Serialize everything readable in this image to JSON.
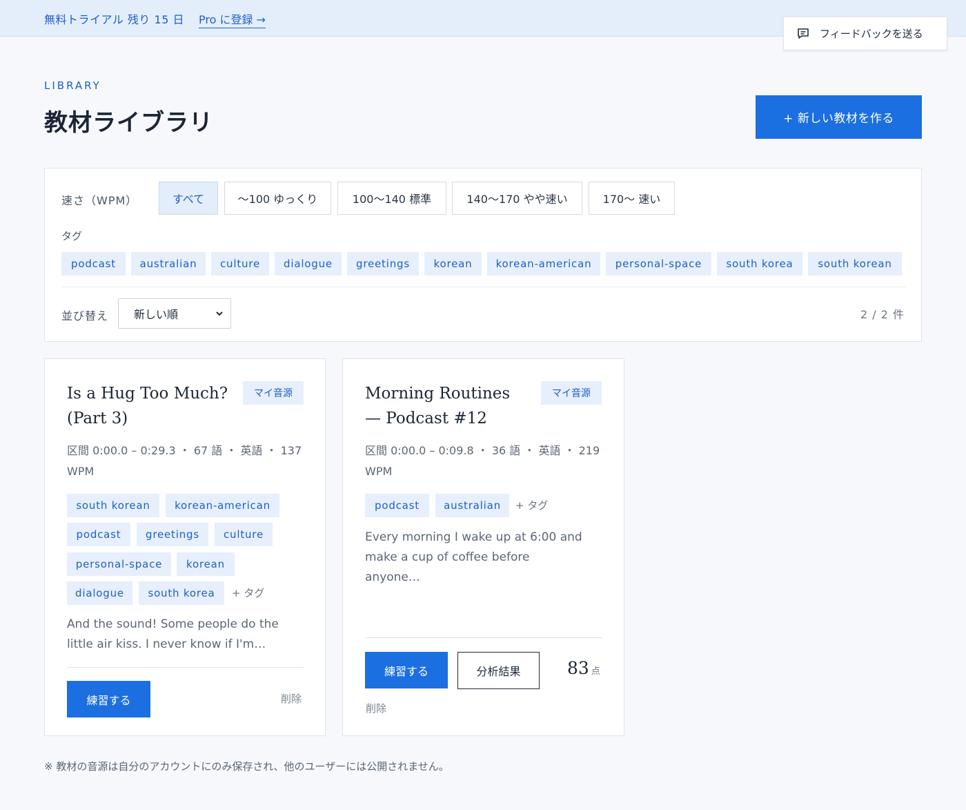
{
  "trial": {
    "text": "無料トライアル 残り 15 日",
    "link": "Pro に登録 →"
  },
  "feedback": {
    "label": "フィードバックを送る",
    "icon": "chat-icon"
  },
  "header": {
    "eyebrow": "LIBRARY",
    "title": "教材ライブラリ",
    "new_button": "+ 新しい教材を作る"
  },
  "filters": {
    "speed_label": "速さ（WPM）",
    "speed_options": [
      "すべて",
      "〜100 ゆっくり",
      "100〜140 標準",
      "140〜170 やや速い",
      "170〜 速い"
    ],
    "speed_selected": "すべて",
    "tag_label": "タグ",
    "tags": [
      "podcast",
      "australian",
      "culture",
      "dialogue",
      "greetings",
      "korean",
      "korean-american",
      "personal-space",
      "south korea",
      "south korean"
    ],
    "sort_label": "並び替え",
    "sort_value": "新しい順",
    "count": "2 / 2 件"
  },
  "cards": [
    {
      "title": "Is a Hug Too Much? (Part 3)",
      "badge": "マイ音源",
      "meta": "区間 0:00.0 – 0:29.3 ・ 67 語 ・ 英語 ・ 137 WPM",
      "tags": [
        "south korean",
        "korean-american",
        "podcast",
        "greetings",
        "culture",
        "personal-space",
        "korean",
        "dialogue",
        "south korea"
      ],
      "add_tag": "+ タグ",
      "excerpt": "And the sound! Some people do the little air kiss. I never know if I'm…",
      "practice": "練習する",
      "delete": "削除"
    },
    {
      "title": "Morning Routines — Podcast #12",
      "badge": "マイ音源",
      "meta": "区間 0:00.0 – 0:09.8 ・ 36 語 ・ 英語 ・ 219 WPM",
      "tags": [
        "podcast",
        "australian"
      ],
      "add_tag": "+ タグ",
      "excerpt": "Every morning I wake up at 6:00 and make a cup of coffee before anyone…",
      "practice": "練習する",
      "analysis": "分析結果",
      "score": "83",
      "score_unit": "点",
      "delete": "削除"
    }
  ],
  "footnote": "※ 教材の音源は自分のアカウントにのみ保存され、他のユーザーには公開されません。",
  "colors": {
    "accent": "#1b6fe0",
    "chip_bg": "#e6effb",
    "chip_text": "#1e5fc8",
    "banner_bg": "#e4eefb"
  }
}
